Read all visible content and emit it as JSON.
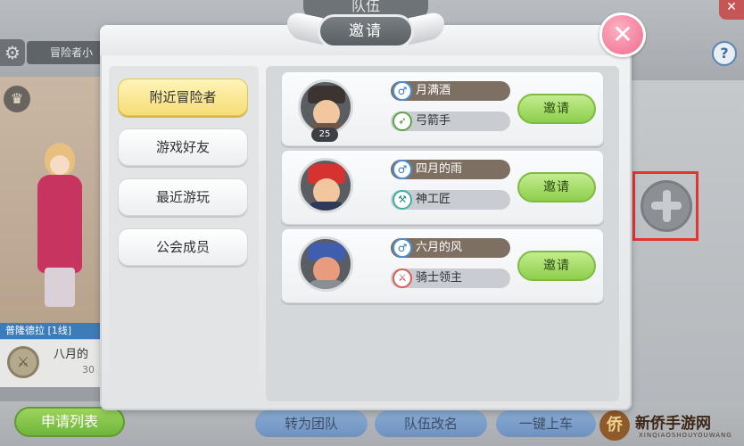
{
  "background": {
    "team_title": "队伍",
    "gear_icon": "gear-icon",
    "name_tab": "冒险者小",
    "help": "?",
    "server_label": "普隆德拉 [1线]",
    "profile_name": "八月的",
    "profile_sub": "30",
    "bottom_buttons": {
      "apply_list": "申请列表",
      "convert_team": "转为团队",
      "rename_team": "队伍改名",
      "one_click": "一键上车"
    },
    "watermark": {
      "title": "新侨手游网",
      "sub": "XINQIAOSHOUYOUWANG",
      "logo": "侨"
    },
    "add_slot_icon": "plus-icon"
  },
  "modal": {
    "title": "邀请",
    "close_icon": "close-icon",
    "tabs": [
      {
        "label": "附近冒险者",
        "active": true
      },
      {
        "label": "游戏好友",
        "active": false
      },
      {
        "label": "最近游玩",
        "active": false
      },
      {
        "label": "公会成员",
        "active": false
      }
    ],
    "players": [
      {
        "name": "月满酒",
        "gender": "♂",
        "class_name": "弓箭手",
        "class_icon": "bow-icon",
        "level": "25",
        "invite_label": "邀请"
      },
      {
        "name": "四月的雨",
        "gender": "♂",
        "class_name": "神工匠",
        "class_icon": "hammer-icon",
        "level": "",
        "invite_label": "邀请"
      },
      {
        "name": "六月的风",
        "gender": "♂",
        "class_name": "骑士领主",
        "class_icon": "lance-icon",
        "level": "",
        "invite_label": "邀请"
      }
    ],
    "colors": {
      "active_tab": "#f6dd77",
      "invite_button": "#8dcf4d",
      "close_button": "#ee6c8b",
      "highlight_frame": "#e33434"
    }
  }
}
